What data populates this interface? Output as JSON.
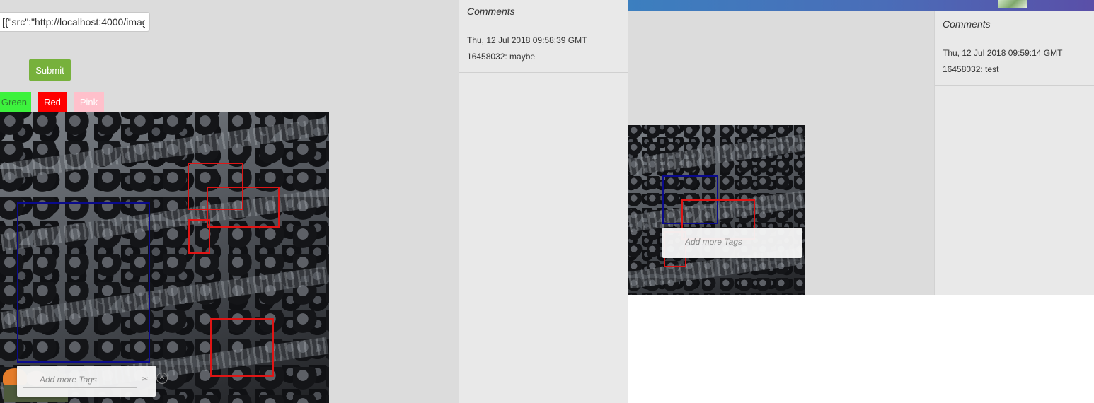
{
  "left": {
    "json_input": {
      "value": "[{\"src\":\"http://localhost:4000/imag"
    },
    "submit_label": "Submit",
    "color_buttons": {
      "green": "Green",
      "red": "Red",
      "pink": "Pink"
    },
    "tag_popup": {
      "placeholder": "Add more Tags",
      "tag_icon": "tag-icon",
      "close_icon": "close-circle-icon"
    },
    "comments": {
      "title": "Comments",
      "date": "Thu, 12 Jul 2018 09:58:39 GMT",
      "text": "16458032: maybe"
    }
  },
  "right": {
    "avatar": "avatar-thumbnail",
    "tag_popup": {
      "placeholder": "Add more Tags"
    },
    "comments": {
      "title": "Comments",
      "date": "Thu, 12 Jul 2018 09:59:14 GMT",
      "text": "16458032: test"
    }
  },
  "colors": {
    "submit": "#77b13c",
    "green": "#3df23d",
    "red": "#ff0000",
    "pink": "#ffc0cb",
    "box_red": "#e01515",
    "box_navy": "#0a0a8c"
  }
}
